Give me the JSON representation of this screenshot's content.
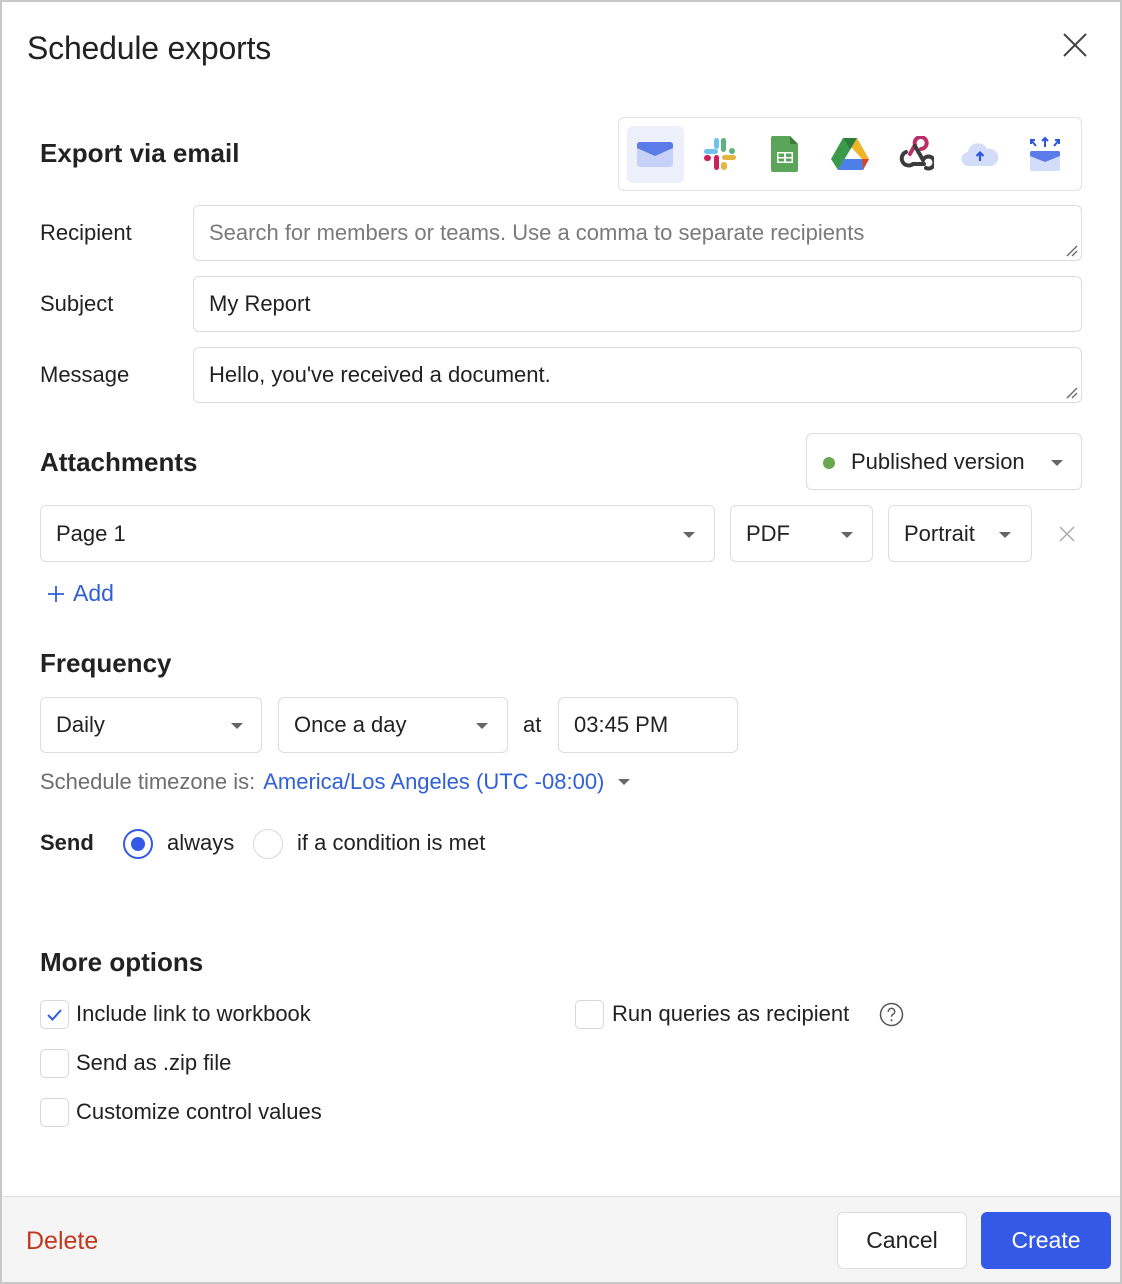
{
  "dialog": {
    "title": "Schedule exports",
    "close_icon": "close-icon"
  },
  "export": {
    "heading": "Export via email",
    "channels": [
      {
        "name": "email",
        "icon": "email-icon",
        "active": true
      },
      {
        "name": "slack",
        "icon": "slack-icon",
        "active": false
      },
      {
        "name": "google-sheets",
        "icon": "google-sheets-icon",
        "active": false
      },
      {
        "name": "google-drive",
        "icon": "google-drive-icon",
        "active": false
      },
      {
        "name": "webhook",
        "icon": "webhook-icon",
        "active": false
      },
      {
        "name": "cloud-storage",
        "icon": "cloud-upload-icon",
        "active": false
      },
      {
        "name": "export-box",
        "icon": "export-box-icon",
        "active": false
      }
    ]
  },
  "form": {
    "recipient_label": "Recipient",
    "recipient_placeholder": "Search for members or teams. Use a comma to separate recipients",
    "recipient_value": "",
    "subject_label": "Subject",
    "subject_value": "My Report",
    "message_label": "Message",
    "message_value": "Hello, you've received a document."
  },
  "attachments": {
    "heading": "Attachments",
    "version": "Published version",
    "version_status_color": "#6aa84f",
    "page": "Page 1",
    "format": "PDF",
    "orientation": "Portrait",
    "add_label": "Add",
    "add_icon": "plus-icon"
  },
  "frequency": {
    "heading": "Frequency",
    "period": "Daily",
    "times": "Once a day",
    "at_label": "at",
    "time": "03:45 PM",
    "timezone_prefix": "Schedule timezone is:",
    "timezone": "America/Los Angeles (UTC -08:00)",
    "send_label": "Send",
    "send_options": [
      {
        "label": "always",
        "selected": true
      },
      {
        "label": "if a condition is met",
        "selected": false
      }
    ]
  },
  "more_options": {
    "heading": "More options",
    "options": [
      {
        "label": "Include link to workbook",
        "checked": true
      },
      {
        "label": "Send as .zip file",
        "checked": false
      },
      {
        "label": "Customize control values",
        "checked": false
      },
      {
        "label": "Run queries as recipient",
        "checked": false
      }
    ]
  },
  "footer": {
    "delete_label": "Delete",
    "cancel_label": "Cancel",
    "create_label": "Create"
  },
  "colors": {
    "primary": "#3459e6",
    "link": "#3060d8",
    "danger": "#c0391e"
  }
}
